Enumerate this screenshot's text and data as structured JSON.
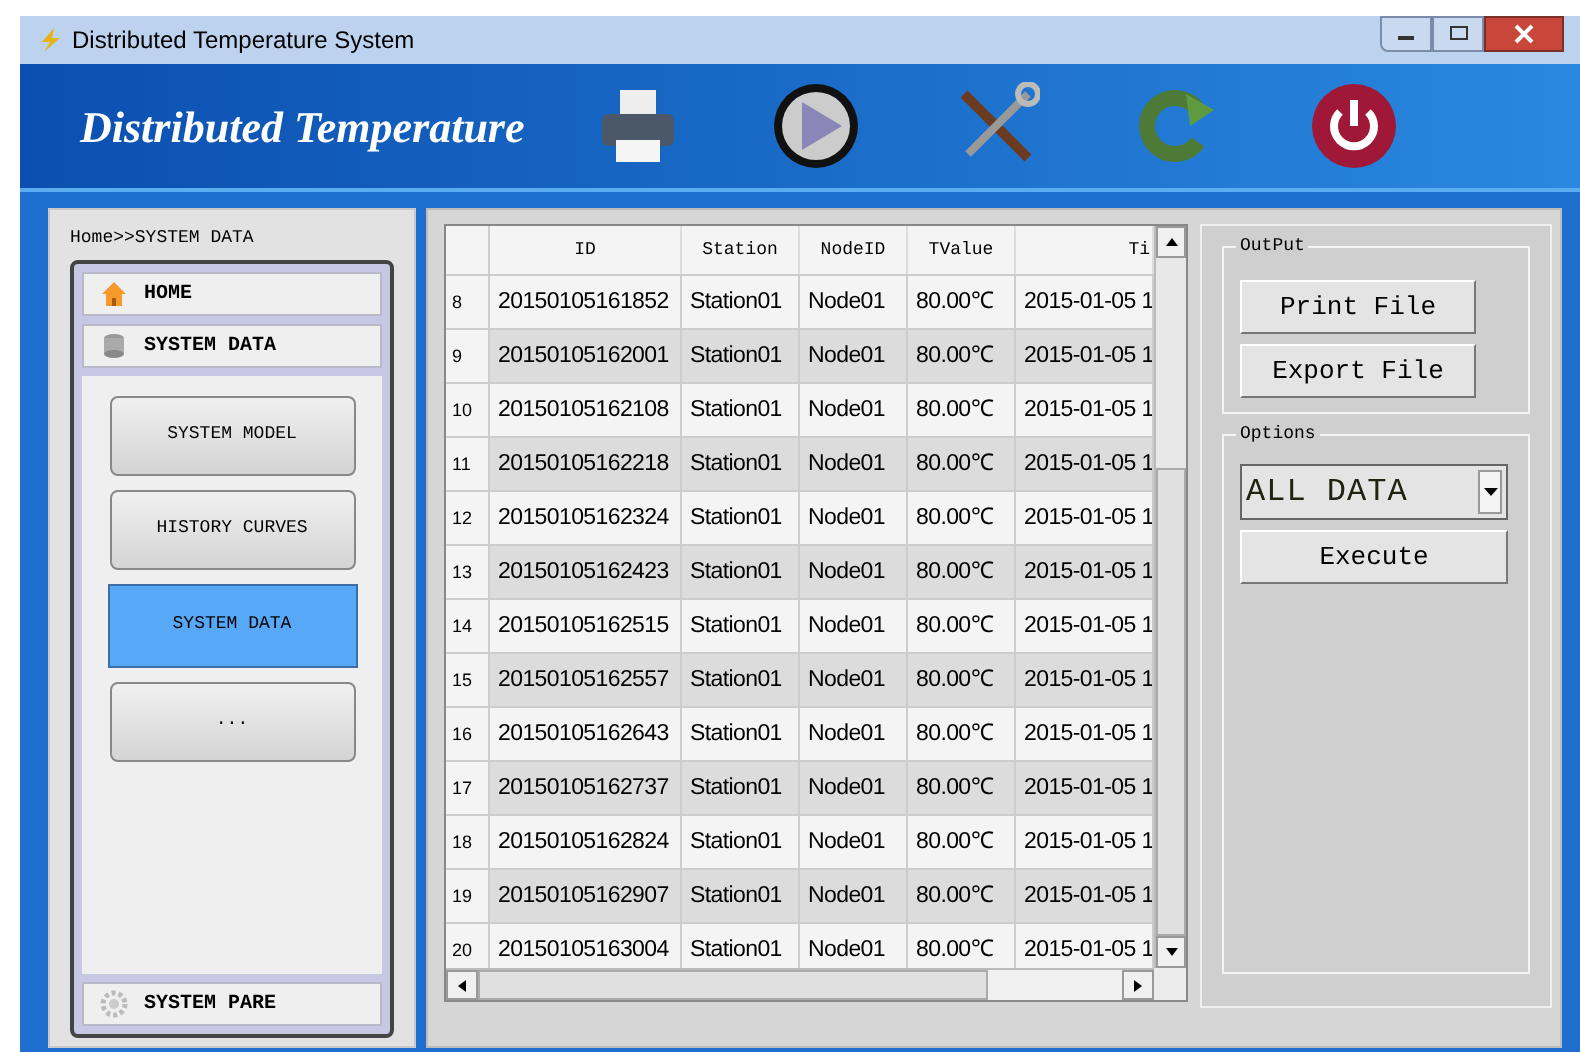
{
  "window": {
    "title": "Distributed Temperature System"
  },
  "header": {
    "title": "Distributed Temperature"
  },
  "breadcrumb": "Home>>SYSTEM DATA",
  "nav": {
    "sections": [
      {
        "label": "HOME",
        "kind": "home"
      },
      {
        "label": "SYSTEM DATA",
        "kind": "data"
      }
    ],
    "buttons": [
      {
        "label": "SYSTEM MODEL",
        "selected": false
      },
      {
        "label": "HISTORY CURVES",
        "selected": false
      },
      {
        "label": "SYSTEM DATA",
        "selected": true
      },
      {
        "label": "...",
        "selected": false
      }
    ],
    "footer": {
      "label": "SYSTEM PARE",
      "kind": "settings"
    }
  },
  "table": {
    "columns": [
      "ID",
      "Station",
      "NodeID",
      "TValue",
      "Ti"
    ],
    "rows": [
      {
        "num": "8",
        "cells": [
          "20150105161852",
          "Station01",
          "Node01",
          "80.00℃",
          "2015-01-05 1"
        ]
      },
      {
        "num": "9",
        "cells": [
          "20150105162001",
          "Station01",
          "Node01",
          "80.00℃",
          "2015-01-05 1"
        ]
      },
      {
        "num": "10",
        "cells": [
          "20150105162108",
          "Station01",
          "Node01",
          "80.00℃",
          "2015-01-05 1"
        ]
      },
      {
        "num": "11",
        "cells": [
          "20150105162218",
          "Station01",
          "Node01",
          "80.00℃",
          "2015-01-05 1"
        ]
      },
      {
        "num": "12",
        "cells": [
          "20150105162324",
          "Station01",
          "Node01",
          "80.00℃",
          "2015-01-05 1"
        ]
      },
      {
        "num": "13",
        "cells": [
          "20150105162423",
          "Station01",
          "Node01",
          "80.00℃",
          "2015-01-05 1"
        ]
      },
      {
        "num": "14",
        "cells": [
          "20150105162515",
          "Station01",
          "Node01",
          "80.00℃",
          "2015-01-05 1"
        ]
      },
      {
        "num": "15",
        "cells": [
          "20150105162557",
          "Station01",
          "Node01",
          "80.00℃",
          "2015-01-05 1"
        ]
      },
      {
        "num": "16",
        "cells": [
          "20150105162643",
          "Station01",
          "Node01",
          "80.00℃",
          "2015-01-05 1"
        ]
      },
      {
        "num": "17",
        "cells": [
          "20150105162737",
          "Station01",
          "Node01",
          "80.00℃",
          "2015-01-05 1"
        ]
      },
      {
        "num": "18",
        "cells": [
          "20150105162824",
          "Station01",
          "Node01",
          "80.00℃",
          "2015-01-05 1"
        ]
      },
      {
        "num": "19",
        "cells": [
          "20150105162907",
          "Station01",
          "Node01",
          "80.00℃",
          "2015-01-05 1"
        ]
      },
      {
        "num": "20",
        "cells": [
          "20150105163004",
          "Station01",
          "Node01",
          "80.00℃",
          "2015-01-05 1"
        ]
      }
    ]
  },
  "output": {
    "title": "OutPut",
    "buttons": [
      "Print File",
      "Export File"
    ]
  },
  "options": {
    "title": "Options",
    "select": "ALL DATA",
    "button": "Execute"
  }
}
